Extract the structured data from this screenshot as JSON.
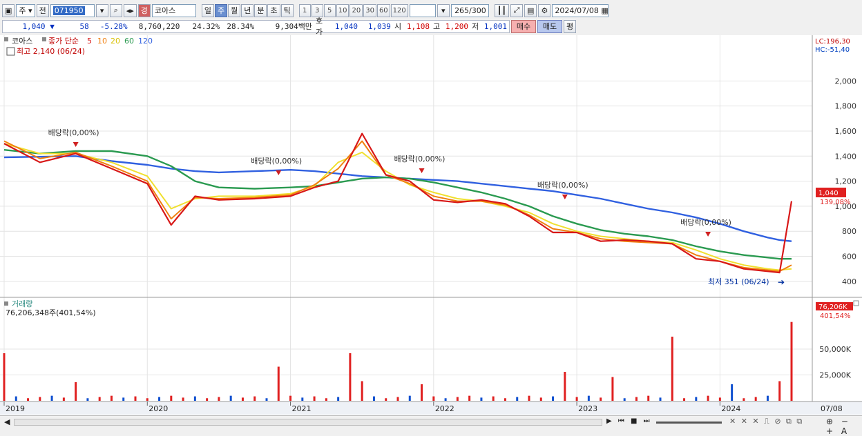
{
  "toolbar": {
    "type_select": "주",
    "prev_label": "전",
    "code": "071950",
    "name": "코아스",
    "badge": "경",
    "period_tabs": [
      "일",
      "주",
      "월",
      "년",
      "분",
      "초",
      "틱"
    ],
    "active_period": "주",
    "interval_buttons": [
      "1",
      "3",
      "5",
      "10",
      "20",
      "30",
      "60",
      "120"
    ],
    "count": "265",
    "count_max": "/300",
    "date": "2024/07/08"
  },
  "quote": {
    "price": "1,040",
    "change": "58",
    "change_pct": "-5.28%",
    "volume": "8,760,220",
    "turnover_pct": "24.32%",
    "ratio_pct": "28.34%",
    "value": "9,304백만",
    "ask_label": "호가",
    "ask1": "1,040",
    "ask2": "1,039",
    "open_label": "시",
    "open": "1,108",
    "high_label": "고",
    "high": "1,200",
    "low_label": "저",
    "low": "1,001",
    "buy_label": "매수",
    "sell_label": "매도",
    "avg_label": "평"
  },
  "legend": {
    "stock": "코아스",
    "ma_label": "종가 단순",
    "periods": [
      "5",
      "10",
      "20",
      "60",
      "120"
    ],
    "lc": "LC:196,30",
    "hc": "HC:-51,40"
  },
  "price_panel": {
    "high_note": "최고 2,140 (06/24)",
    "low_note": "최저 351 (06/24)",
    "price_tag": "1,040",
    "pct_tag": "139,08%",
    "dividend_labels": [
      {
        "text": "배당락(0,00%)",
        "date": "2019-07"
      },
      {
        "text": "배당락(0,00%)",
        "date": "2020-12"
      },
      {
        "text": "배당락(0,00%)",
        "date": "2021-12"
      },
      {
        "text": "배당락(0,00%)",
        "date": "2022-12"
      },
      {
        "text": "배당락(0,00%)",
        "date": "2023-12"
      }
    ]
  },
  "volume_panel": {
    "title": "거래량",
    "current": "76,206,348주(401,54%)",
    "tag_value": "76,206K",
    "tag_pct": "401,54%"
  },
  "axis": {
    "x_labels": [
      "2019",
      "2020",
      "2021",
      "2022",
      "2023",
      "2024",
      "07/08"
    ]
  },
  "colors": {
    "up": "#e02020",
    "down": "#1050d0",
    "ma5": "#d81818",
    "ma10": "#f08010",
    "ma20": "#f0e030",
    "ma60": "#2a9a50",
    "ma120": "#3060e0"
  },
  "chart_data": {
    "type": "line",
    "title": "",
    "x_range": [
      "2019-01",
      "2024-07"
    ],
    "price_ylim": [
      300,
      2200
    ],
    "price_ticks": [
      400,
      600,
      800,
      1000,
      1200,
      1400,
      1600,
      1800,
      2000
    ],
    "price_tick_labels": [
      "400",
      "600",
      "800",
      "1,000",
      "1,200",
      "1,400",
      "1,600",
      "1,800",
      "2,000"
    ],
    "volume_ticks": [
      25000,
      50000
    ],
    "volume_tick_labels": [
      "25,000K",
      "50,000K"
    ],
    "volume_ylim": [
      0,
      80000
    ],
    "dates": [
      "2019-01",
      "2019-04",
      "2019-07",
      "2019-10",
      "2020-01",
      "2020-03",
      "2020-05",
      "2020-07",
      "2020-10",
      "2021-01",
      "2021-03",
      "2021-05",
      "2021-07",
      "2021-09",
      "2021-11",
      "2022-01",
      "2022-03",
      "2022-05",
      "2022-07",
      "2022-09",
      "2022-11",
      "2023-01",
      "2023-03",
      "2023-05",
      "2023-07",
      "2023-09",
      "2023-11",
      "2024-01",
      "2024-03",
      "2024-05",
      "2024-06",
      "2024-07"
    ],
    "series": [
      {
        "name": "5",
        "values": [
          1500,
          1350,
          1420,
          1300,
          1180,
          850,
          1080,
          1050,
          1060,
          1080,
          1150,
          1200,
          1580,
          1250,
          1200,
          1050,
          1030,
          1050,
          1020,
          920,
          790,
          790,
          720,
          730,
          720,
          700,
          580,
          560,
          500,
          480,
          470,
          1040
        ]
      },
      {
        "name": "10",
        "values": [
          1520,
          1380,
          1430,
          1320,
          1200,
          900,
          1070,
          1060,
          1070,
          1090,
          1170,
          1300,
          1520,
          1250,
          1180,
          1080,
          1040,
          1040,
          1010,
          930,
          820,
          790,
          740,
          720,
          710,
          700,
          610,
          560,
          510,
          490,
          480,
          530
        ]
      },
      {
        "name": "20",
        "values": [
          1500,
          1420,
          1420,
          1350,
          1240,
          980,
          1060,
          1080,
          1080,
          1100,
          1160,
          1350,
          1430,
          1280,
          1170,
          1110,
          1060,
          1040,
          1000,
          950,
          860,
          800,
          760,
          740,
          720,
          710,
          650,
          580,
          530,
          500,
          490,
          500
        ]
      },
      {
        "name": "60",
        "values": [
          1450,
          1420,
          1440,
          1440,
          1400,
          1320,
          1200,
          1150,
          1140,
          1150,
          1160,
          1190,
          1220,
          1230,
          1220,
          1190,
          1150,
          1110,
          1060,
          1000,
          920,
          860,
          810,
          780,
          760,
          730,
          680,
          640,
          610,
          590,
          580,
          580
        ]
      },
      {
        "name": "120",
        "values": [
          1390,
          1395,
          1400,
          1360,
          1330,
          1300,
          1280,
          1270,
          1280,
          1290,
          1280,
          1260,
          1240,
          1230,
          1220,
          1210,
          1200,
          1180,
          1160,
          1140,
          1120,
          1090,
          1060,
          1020,
          980,
          950,
          910,
          860,
          800,
          750,
          730,
          720
        ]
      }
    ],
    "volume_spikes": [
      {
        "date": "2019-01",
        "value": 46000
      },
      {
        "date": "2019-07",
        "value": 18000
      },
      {
        "date": "2020-12",
        "value": 33000
      },
      {
        "date": "2021-06",
        "value": 46000
      },
      {
        "date": "2021-07",
        "value": 19000
      },
      {
        "date": "2021-12",
        "value": 16000
      },
      {
        "date": "2022-12",
        "value": 28000
      },
      {
        "date": "2023-04",
        "value": 23000
      },
      {
        "date": "2023-09",
        "value": 62000
      },
      {
        "date": "2024-02",
        "value": 16000
      },
      {
        "date": "2024-06",
        "value": 19000
      },
      {
        "date": "2024-07",
        "value": 76206
      }
    ]
  }
}
